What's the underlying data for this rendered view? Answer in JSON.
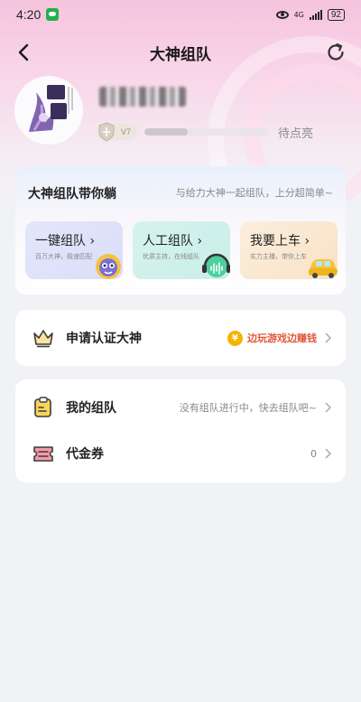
{
  "status_bar": {
    "time": "4:20",
    "network": "4G",
    "battery": "92"
  },
  "nav": {
    "title": "大神组队"
  },
  "profile": {
    "level": "V7",
    "level_progress": 0.35,
    "pending_text": "待点亮"
  },
  "team_card": {
    "title": "大神组队带你躺",
    "subtitle": "与给力大神一起组队，上分超简单~",
    "options": [
      {
        "label": "一键组队",
        "desc": "百万大神，极速匹配"
      },
      {
        "label": "人工组队",
        "desc": "优质主持，在线组队"
      },
      {
        "label": "我要上车",
        "desc": "实力主播，带你上车"
      }
    ]
  },
  "certify": {
    "label": "申请认证大神",
    "coin_symbol": "¥",
    "promo": "边玩游戏边赚钱"
  },
  "list": {
    "my_team": {
      "label": "我的组队",
      "note": "没有组队进行中，快去组队吧~"
    },
    "voucher": {
      "label": "代金券",
      "count": "0"
    }
  },
  "colors": {
    "accent_pink": "#f6c4de",
    "promo_red": "#e2583a",
    "coin_gold": "#f4b400"
  },
  "icons": {
    "back": "chevron-left-icon",
    "refresh": "refresh-icon",
    "crown": "crown-icon",
    "team": "team-clipboard-icon",
    "voucher": "voucher-icon"
  }
}
